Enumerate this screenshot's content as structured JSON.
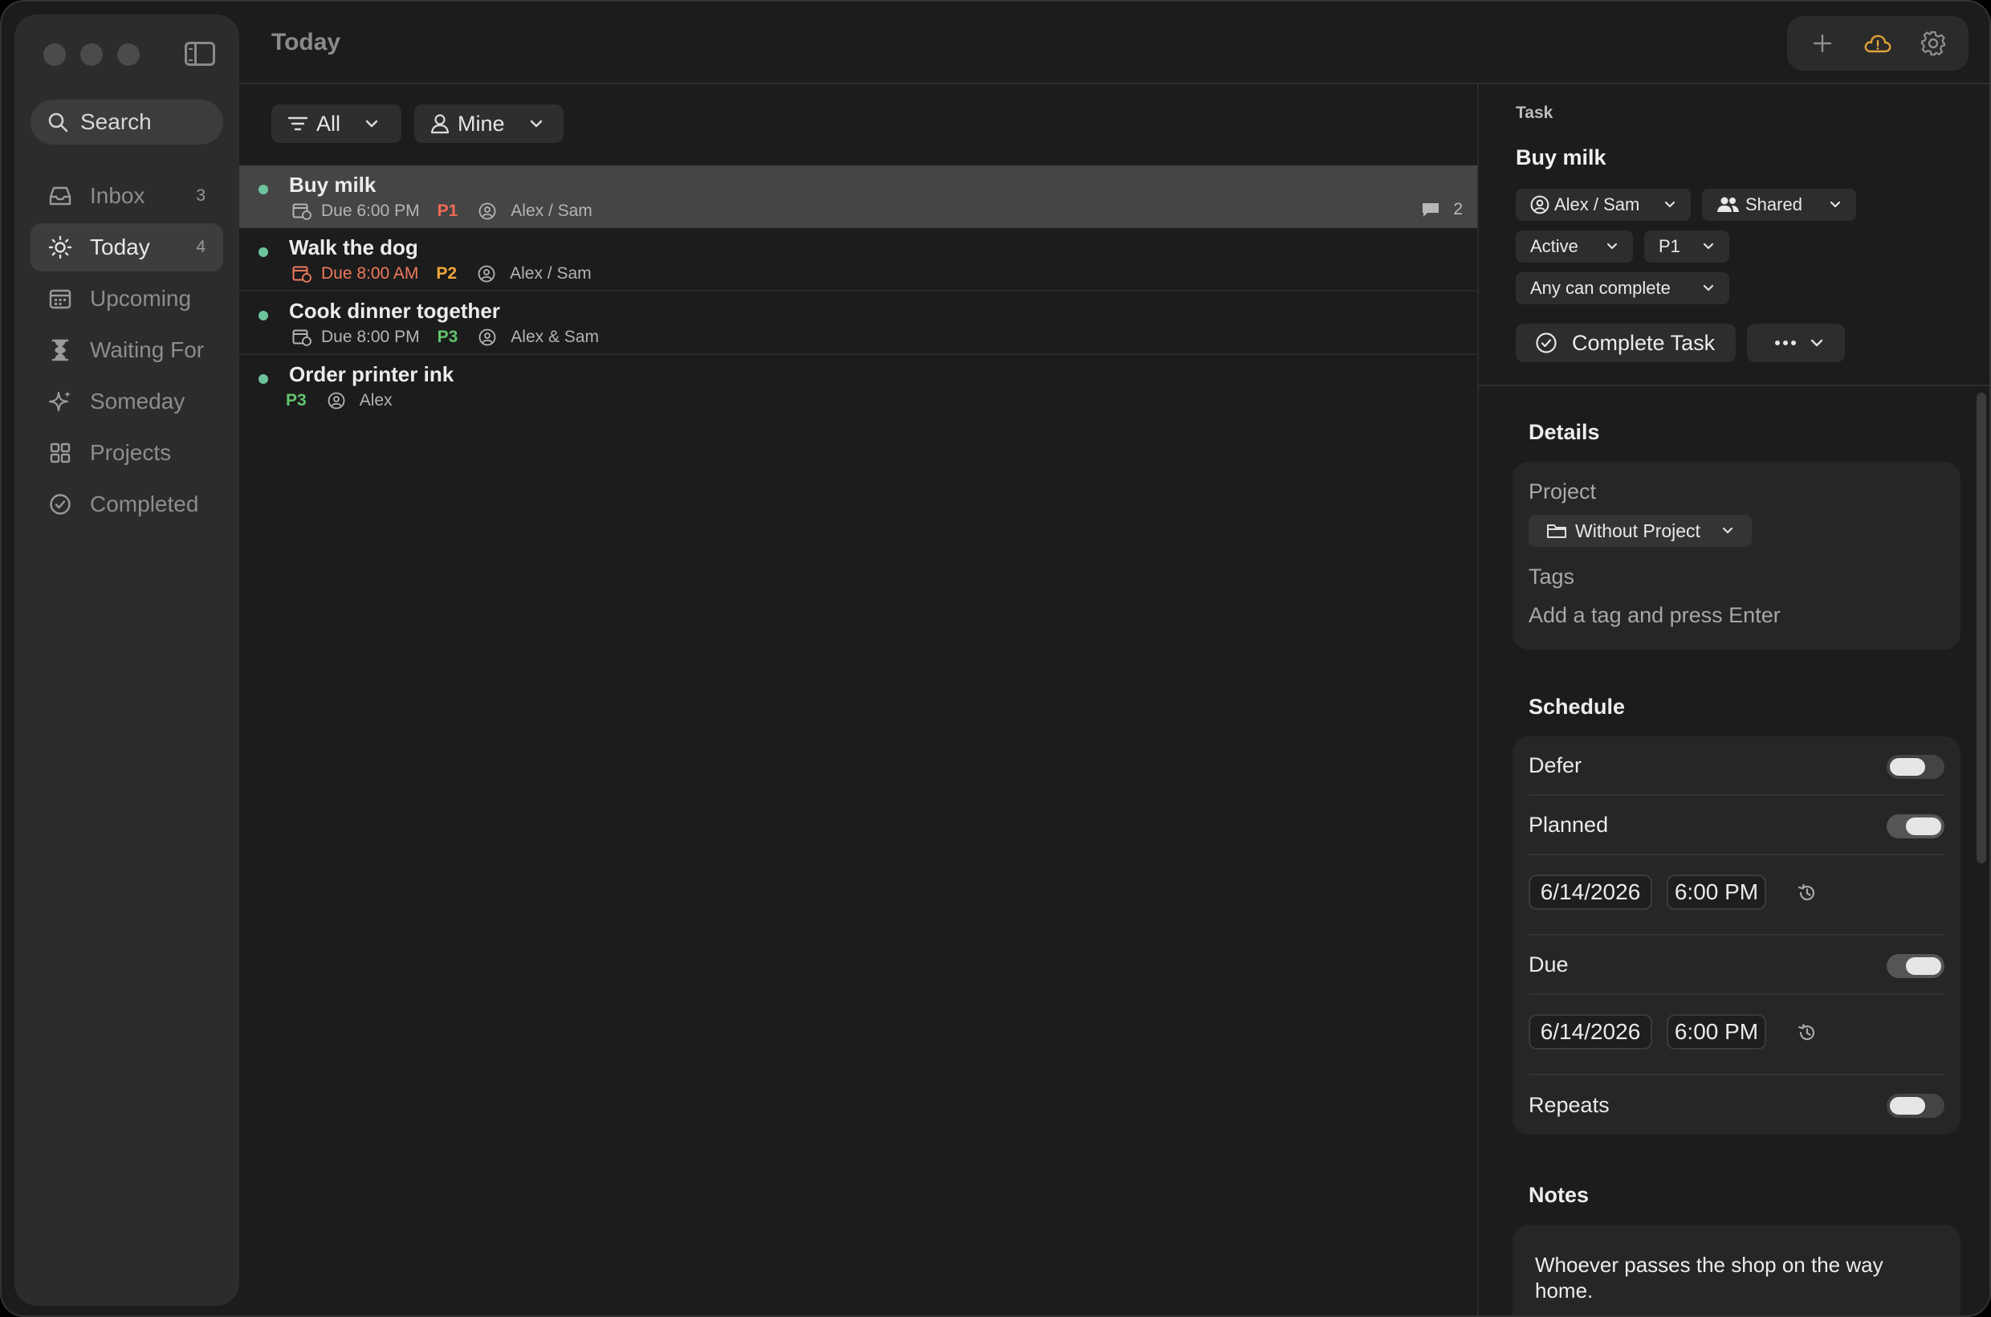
{
  "window": {
    "title": "Today"
  },
  "sidebar": {
    "search_label": "Search",
    "items": [
      {
        "label": "Inbox",
        "count": "3",
        "icon": "inbox-icon"
      },
      {
        "label": "Today",
        "count": "4",
        "icon": "sun-icon",
        "active": true
      },
      {
        "label": "Upcoming",
        "count": "",
        "icon": "calendar-icon"
      },
      {
        "label": "Waiting For",
        "count": "",
        "icon": "hourglass-icon"
      },
      {
        "label": "Someday",
        "count": "",
        "icon": "sparkle-icon"
      },
      {
        "label": "Projects",
        "count": "",
        "icon": "grid-icon"
      },
      {
        "label": "Completed",
        "count": "",
        "icon": "check-circle-icon"
      }
    ]
  },
  "filters": {
    "all_label": "All",
    "mine_label": "Mine"
  },
  "tasks": [
    {
      "title": "Buy milk",
      "due": "Due 6:00 PM",
      "due_overdue": false,
      "priority": "P1",
      "assignee": "Alex / Sam",
      "comments": "2",
      "selected": true
    },
    {
      "title": "Walk the dog",
      "due": "Due 8:00 AM",
      "due_overdue": true,
      "priority": "P2",
      "assignee": "Alex / Sam"
    },
    {
      "title": "Cook dinner together",
      "due": "Due 8:00 PM",
      "due_overdue": false,
      "priority": "P3",
      "assignee": "Alex & Sam"
    },
    {
      "title": "Order printer ink",
      "due": "",
      "priority": "P3",
      "assignee": "Alex"
    }
  ],
  "detail": {
    "section_label": "Task",
    "title": "Buy milk",
    "assignee": "Alex / Sam",
    "sharing": "Shared",
    "status": "Active",
    "priority": "P1",
    "completion_rule": "Any can complete",
    "complete_button": "Complete Task",
    "details_heading": "Details",
    "project_label": "Project",
    "project_value": "Without Project",
    "tags_label": "Tags",
    "tags_placeholder": "Add a tag and press Enter",
    "schedule_heading": "Schedule",
    "defer_label": "Defer",
    "defer_on": false,
    "planned_label": "Planned",
    "planned_on": true,
    "planned_date": "6/14/2026",
    "planned_time": "6:00 PM",
    "due_label": "Due",
    "due_on": true,
    "due_date": "6/14/2026",
    "due_time": "6:00 PM",
    "repeats_label": "Repeats",
    "repeats_on": false,
    "notes_heading": "Notes",
    "notes_text": "Whoever passes the shop on the way home."
  },
  "colors": {
    "accent_dot": "#6ec39f",
    "p1": "#ef6b52",
    "p2": "#f0a63a",
    "p3": "#62c46e",
    "cloud_icon": "#e0a23a"
  }
}
